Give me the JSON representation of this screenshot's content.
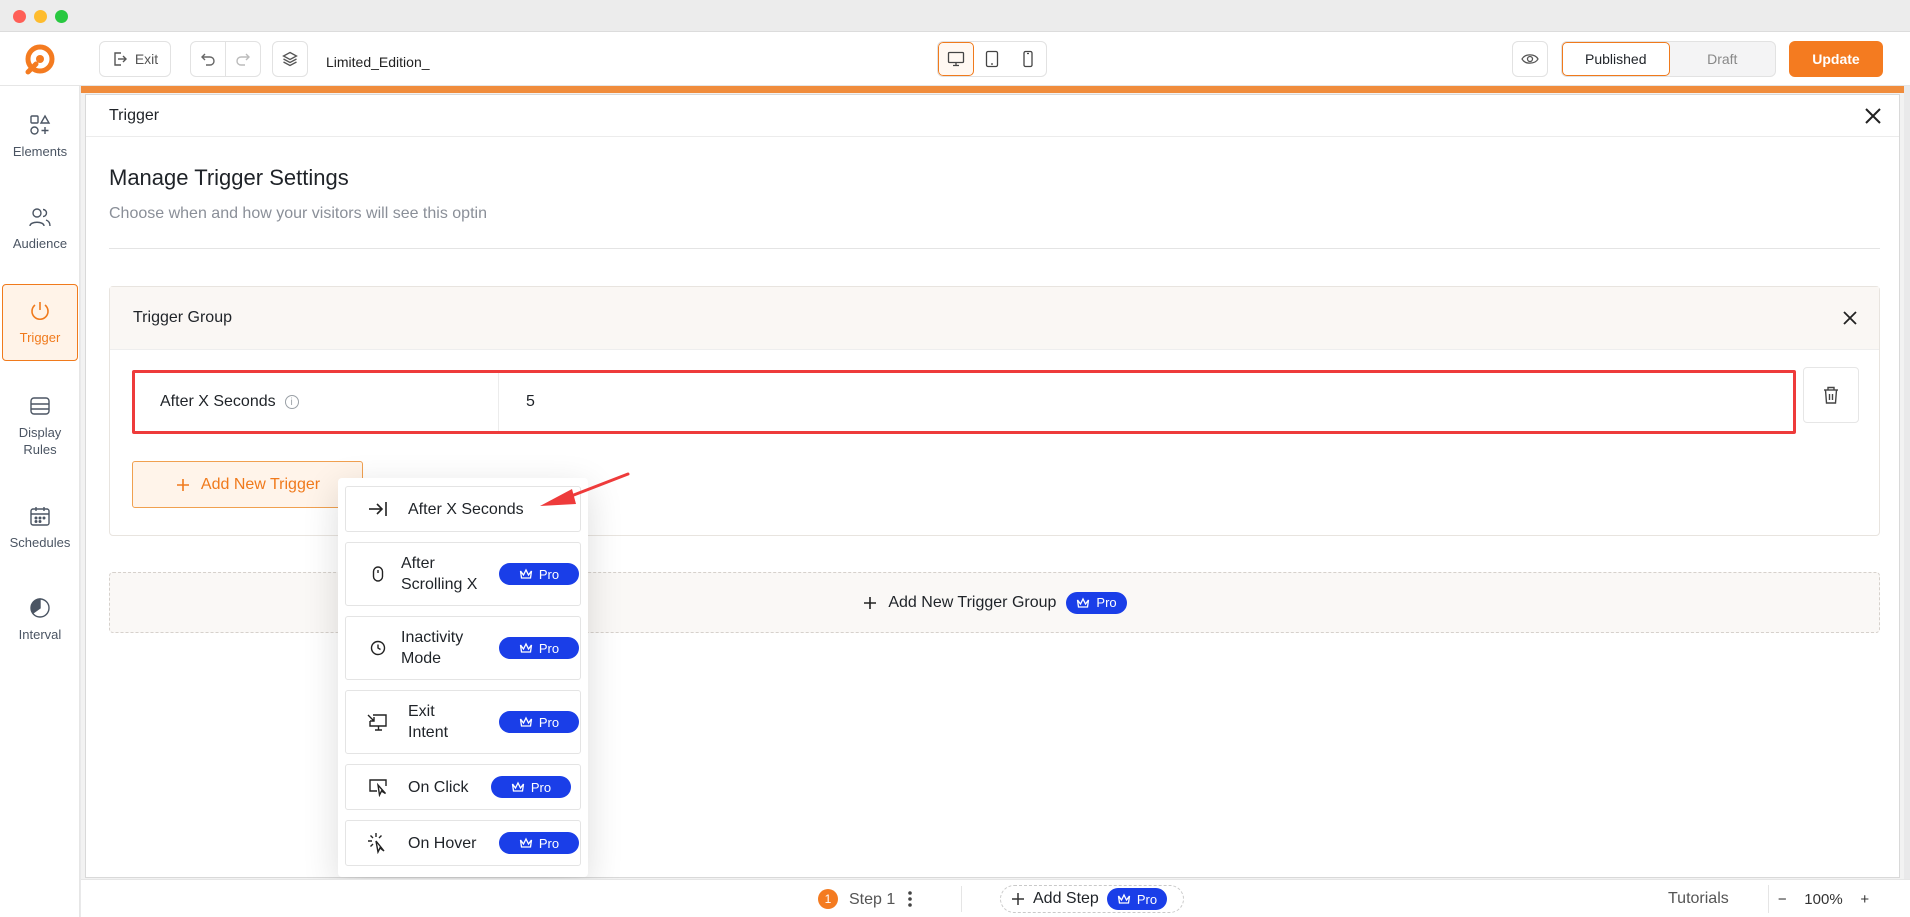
{
  "topbar": {
    "exit_label": "Exit",
    "doc_title": "Limited_Edition_",
    "status_published": "Published",
    "status_draft": "Draft",
    "update_label": "Update"
  },
  "nav": {
    "elements": "Elements",
    "audience": "Audience",
    "trigger": "Trigger",
    "display_rules": "Display Rules",
    "schedules": "Schedules",
    "interval": "Interval"
  },
  "modal": {
    "title": "Trigger",
    "settings_title": "Manage Trigger Settings",
    "settings_subtitle": "Choose when and how your visitors will see this optin",
    "group_title": "Trigger Group",
    "trigger_label": "After X Seconds",
    "trigger_value": "5",
    "add_trigger_label": "Add New Trigger",
    "add_group_label": "Add New Trigger Group"
  },
  "pro_label": "Pro",
  "dropdown": {
    "items": [
      {
        "label": "After X Seconds",
        "icon": "arrow-to-line-icon",
        "pro": false
      },
      {
        "label": "After Scrolling X",
        "icon": "mouse-icon",
        "pro": true
      },
      {
        "label": "Inactivity Mode",
        "icon": "clock-icon",
        "pro": true
      },
      {
        "label": "Exit Intent",
        "icon": "monitor-exit-icon",
        "pro": true
      },
      {
        "label": "On Click",
        "icon": "cursor-click-icon",
        "pro": true
      },
      {
        "label": "On Hover",
        "icon": "sparkle-cursor-icon",
        "pro": true
      }
    ]
  },
  "bottombar": {
    "step_number": "1",
    "step_label": "Step 1",
    "add_step_label": "Add Step",
    "tutorials_label": "Tutorials",
    "zoom_minus": "−",
    "zoom_level": "100%",
    "zoom_plus": "+"
  },
  "colors": {
    "accent": "#f47b20",
    "pro_badge": "#1a3ee8",
    "highlight_border": "#ee3b3b"
  }
}
